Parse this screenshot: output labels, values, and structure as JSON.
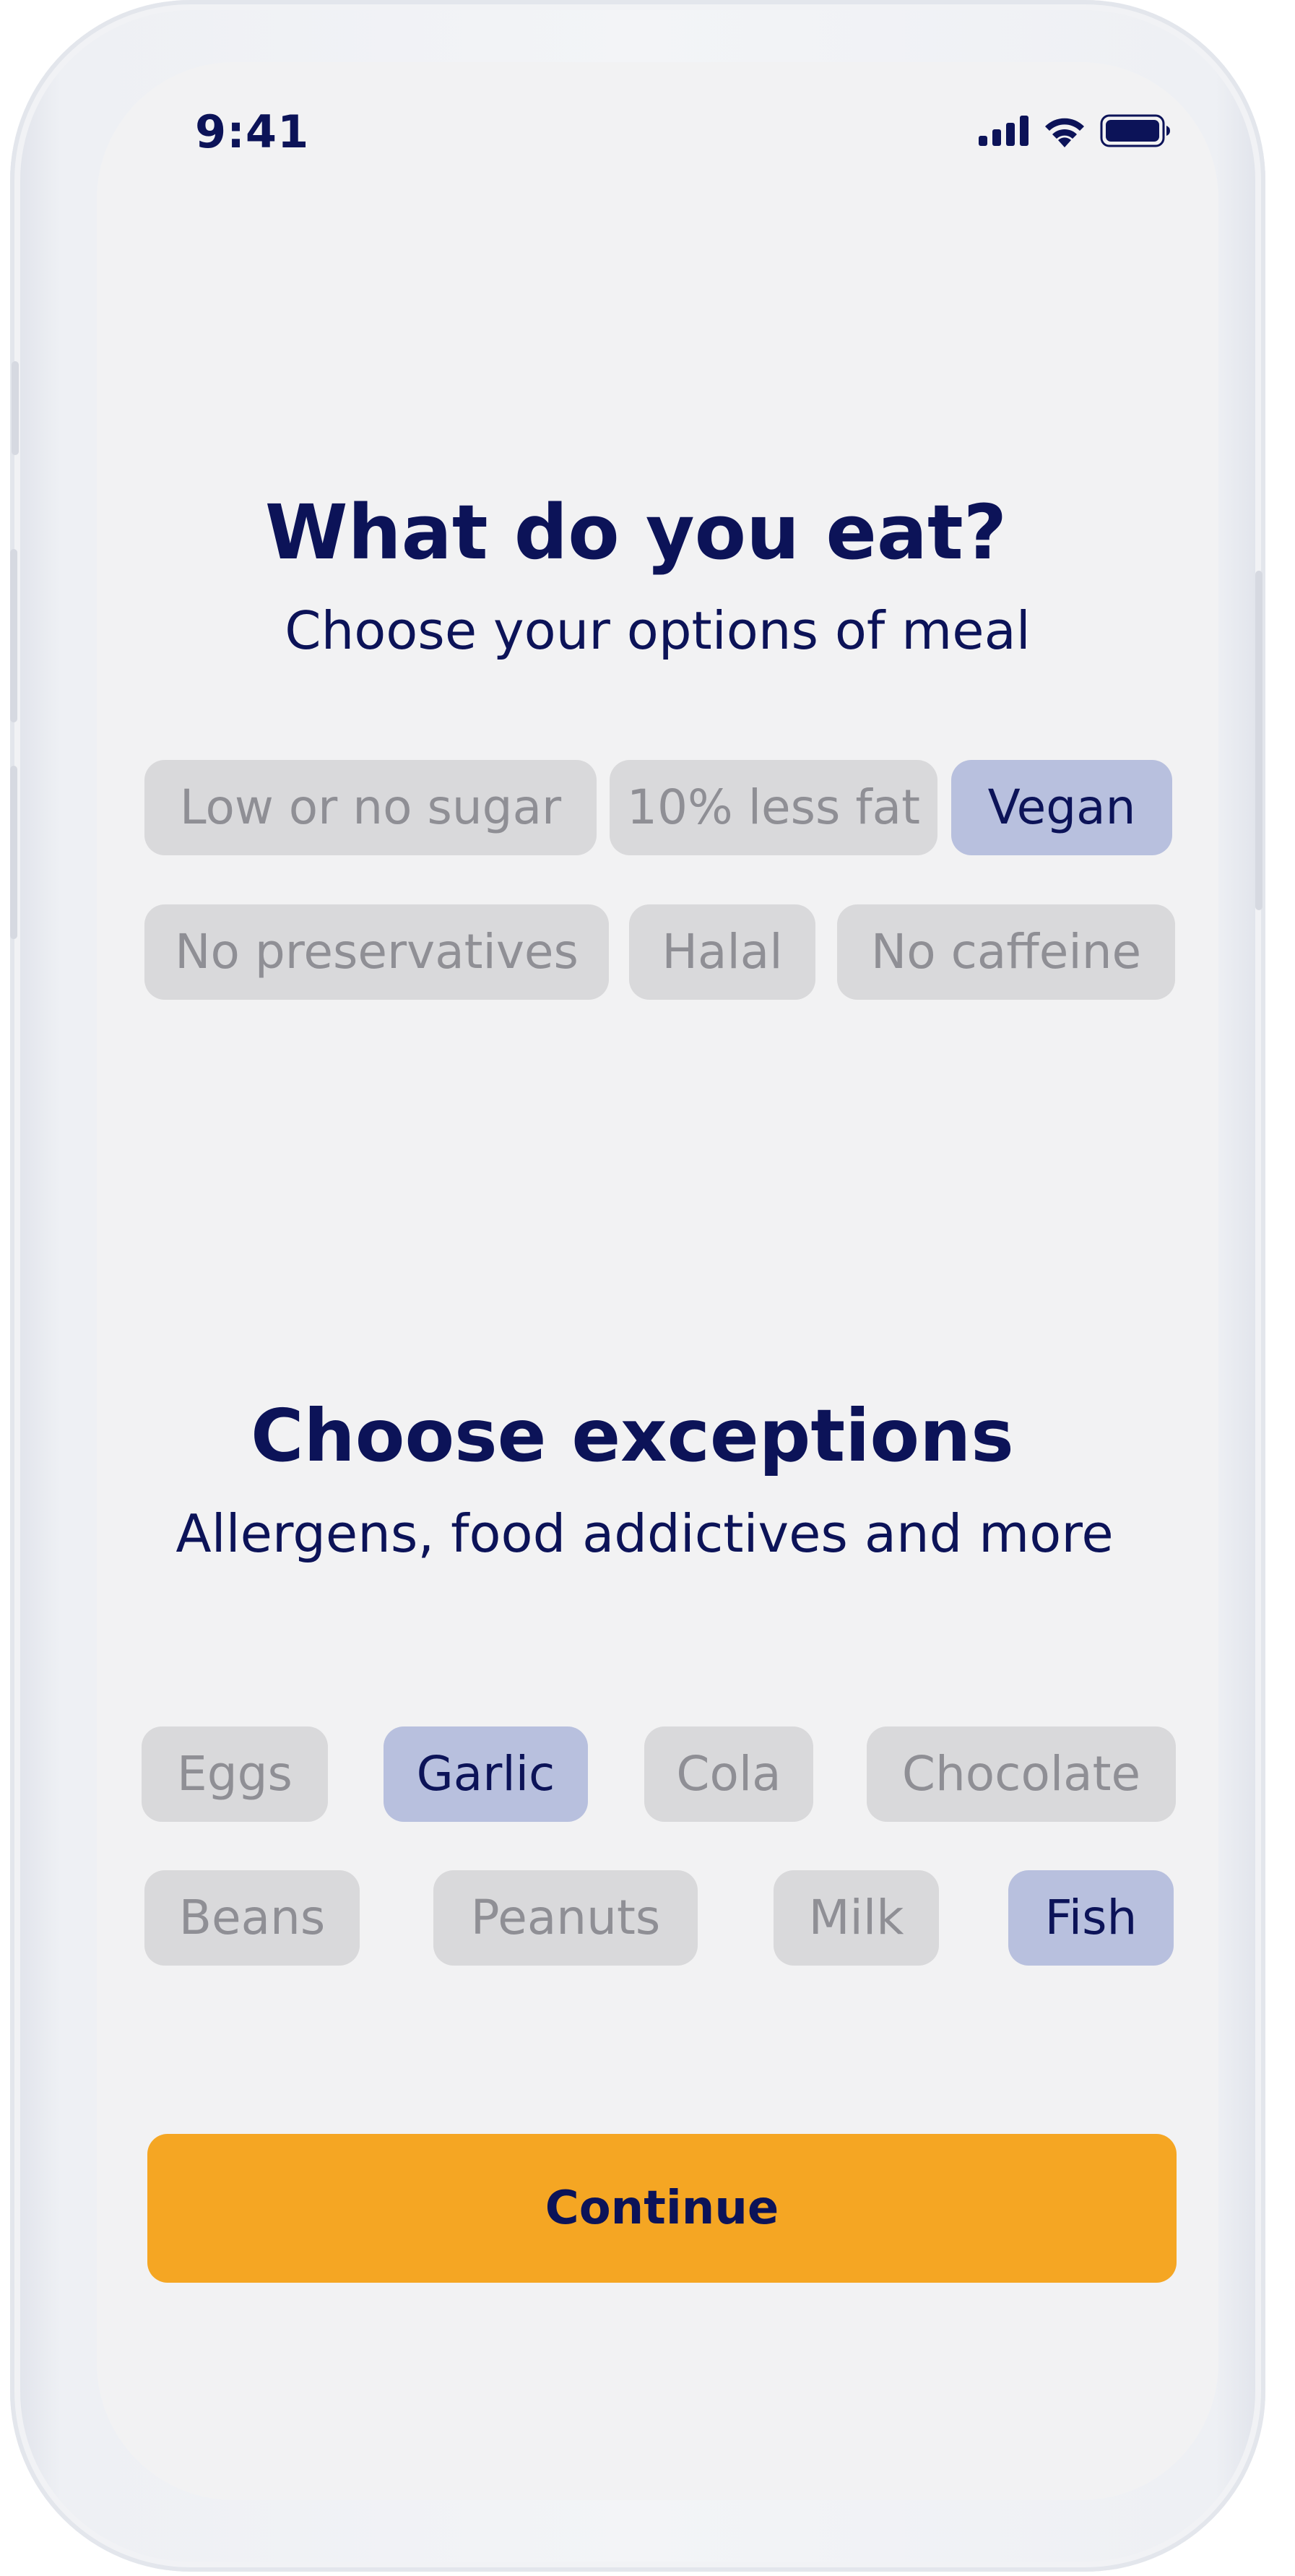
{
  "status_bar": {
    "time": "9:41"
  },
  "meal_section": {
    "title": "What do you eat?",
    "subtitle": "Choose your options of meal",
    "options": [
      {
        "label": "Low or no sugar",
        "selected": false
      },
      {
        "label": "10% less fat",
        "selected": false
      },
      {
        "label": "Vegan",
        "selected": true
      },
      {
        "label": "No preservatives",
        "selected": false
      },
      {
        "label": "Halal",
        "selected": false
      },
      {
        "label": "No caffeine",
        "selected": false
      }
    ]
  },
  "exceptions_section": {
    "title": "Choose exceptions",
    "subtitle": "Allergens, food addictives and more",
    "options": [
      {
        "label": "Eggs",
        "selected": false
      },
      {
        "label": "Garlic",
        "selected": true
      },
      {
        "label": "Cola",
        "selected": false
      },
      {
        "label": "Chocolate",
        "selected": false
      },
      {
        "label": "Beans",
        "selected": false
      },
      {
        "label": "Peanuts",
        "selected": false
      },
      {
        "label": "Milk",
        "selected": false
      },
      {
        "label": "Fish",
        "selected": true
      }
    ]
  },
  "continue_button": {
    "label": "Continue"
  },
  "colors": {
    "primary_text": "#0c1358",
    "chip_default": "#d9d9db",
    "chip_selected": "#b8c0de",
    "accent_button": "#f5a623",
    "screen_background": "#f2f2f3"
  },
  "icons": [
    "signal-icon",
    "wifi-icon",
    "battery-icon"
  ]
}
